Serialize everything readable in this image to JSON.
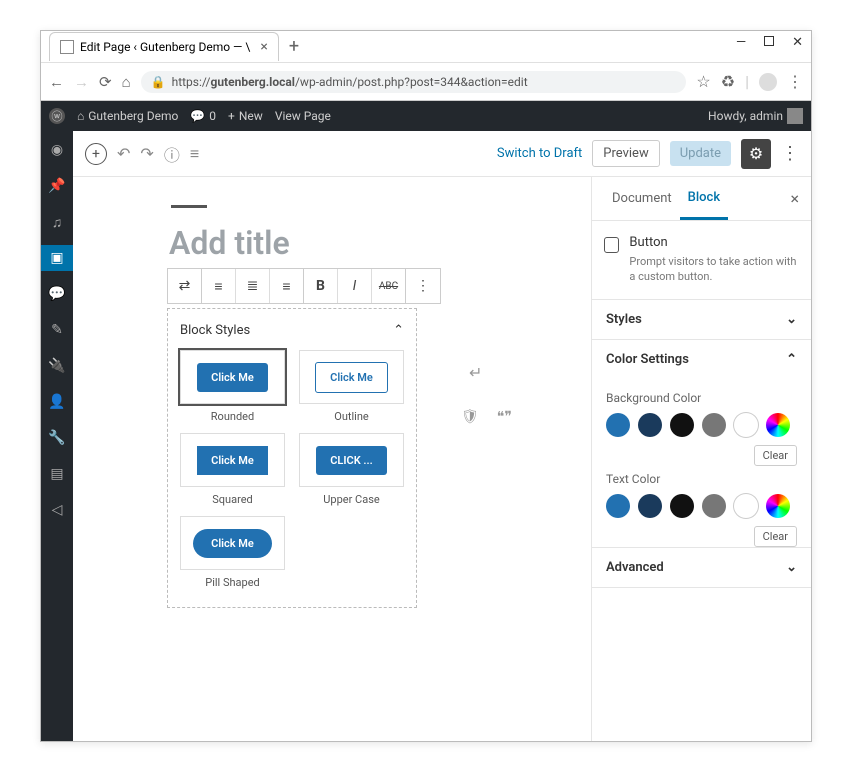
{
  "browser": {
    "tab_title": "Edit Page ‹ Gutenberg Demo — \\",
    "url_prefix": "https://",
    "url_host": "gutenberg.local",
    "url_path": "/wp-admin/post.php?post=344&action=edit"
  },
  "adminbar": {
    "site_name": "Gutenberg Demo",
    "comments_count": "0",
    "new_label": "New",
    "view_page": "View Page",
    "howdy": "Howdy, admin"
  },
  "editor_top": {
    "switch_draft": "Switch to Draft",
    "preview": "Preview",
    "update": "Update"
  },
  "canvas": {
    "title_placeholder": "Add title",
    "toolbar_abc": "ABC"
  },
  "block_styles": {
    "heading": "Block Styles",
    "styles": [
      {
        "label": "Rounded",
        "btn_text": "Click Me",
        "variant": "rounded",
        "selected": true
      },
      {
        "label": "Outline",
        "btn_text": "Click Me",
        "variant": "outline",
        "selected": false
      },
      {
        "label": "Squared",
        "btn_text": "Click Me",
        "variant": "squared",
        "selected": false
      },
      {
        "label": "Upper Case",
        "btn_text": "CLICK ...",
        "variant": "upper",
        "selected": false
      },
      {
        "label": "Pill Shaped",
        "btn_text": "Click Me",
        "variant": "pill",
        "selected": false
      }
    ]
  },
  "sidebar": {
    "tabs": {
      "document": "Document",
      "block": "Block"
    },
    "block_info": {
      "title": "Button",
      "desc": "Prompt visitors to take action with a custom button."
    },
    "panels": {
      "styles": "Styles",
      "color_settings": "Color Settings",
      "advanced": "Advanced"
    },
    "color": {
      "bg_label": "Background Color",
      "text_label": "Text Color",
      "clear": "Clear",
      "swatches": [
        "#2271b1",
        "#1a3a5c",
        "#111111",
        "#777777",
        "#ffffff",
        "conic"
      ]
    }
  }
}
